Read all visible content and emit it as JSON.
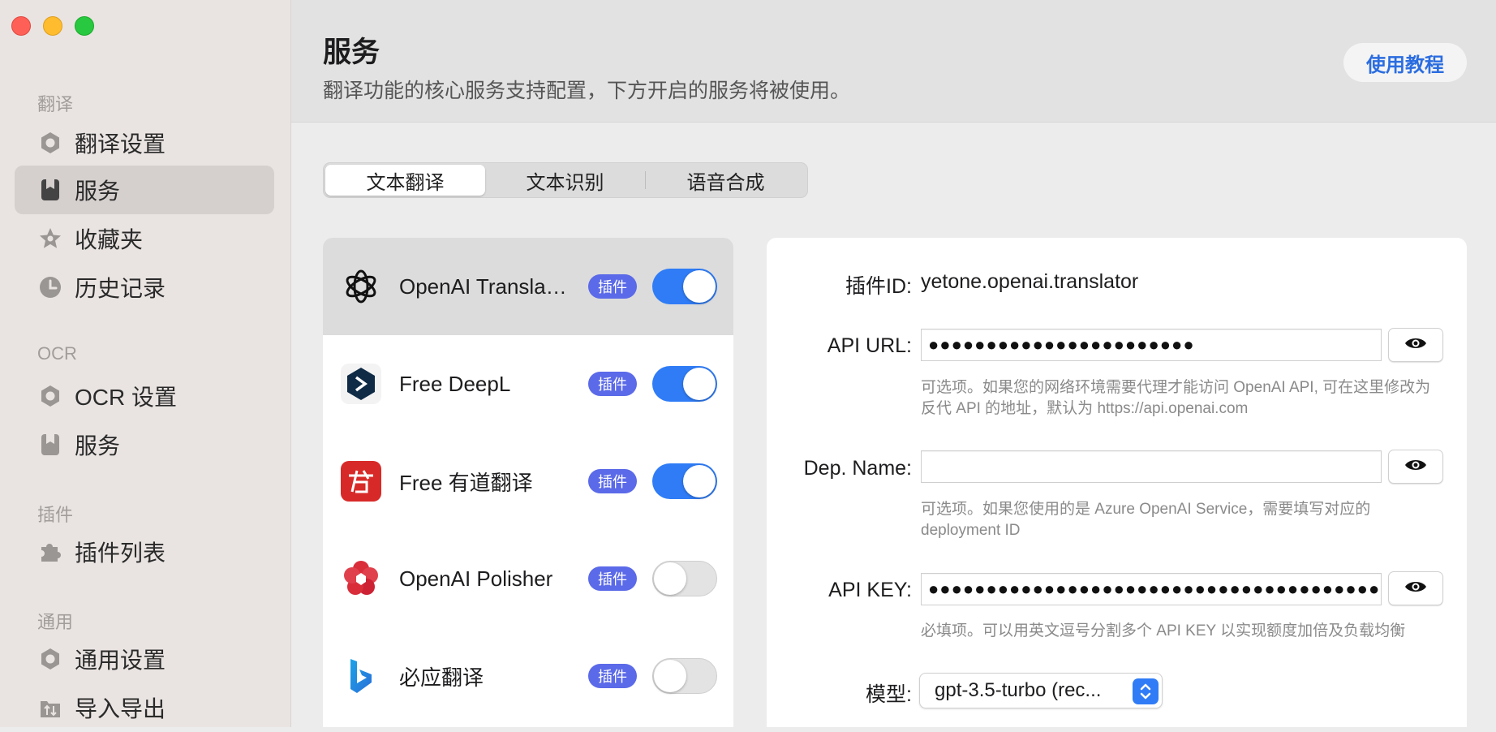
{
  "window": {
    "controls": [
      "close",
      "minimize",
      "zoom"
    ]
  },
  "sidebar": {
    "sections": [
      {
        "title": "翻译",
        "items": [
          {
            "label": "翻译设置",
            "icon": "gear-icon"
          },
          {
            "label": "服务",
            "icon": "bookmark-icon",
            "active": true
          },
          {
            "label": "收藏夹",
            "icon": "star-icon"
          },
          {
            "label": "历史记录",
            "icon": "clock-icon"
          }
        ]
      },
      {
        "title": "OCR",
        "items": [
          {
            "label": "OCR 设置",
            "icon": "gear-icon"
          },
          {
            "label": "服务",
            "icon": "bookmark-icon"
          }
        ]
      },
      {
        "title": "插件",
        "items": [
          {
            "label": "插件列表",
            "icon": "puzzle-icon"
          }
        ]
      },
      {
        "title": "通用",
        "items": [
          {
            "label": "通用设置",
            "icon": "gear-icon"
          },
          {
            "label": "导入导出",
            "icon": "import-export-icon"
          }
        ]
      }
    ]
  },
  "header": {
    "title": "服务",
    "subtitle": "翻译功能的核心服务支持配置，下方开启的服务将被使用。",
    "tutorial_label": "使用教程"
  },
  "tabs": [
    {
      "label": "文本翻译",
      "active": true
    },
    {
      "label": "文本识别"
    },
    {
      "label": "语音合成"
    }
  ],
  "services": [
    {
      "name": "OpenAI Translator",
      "badge": "插件",
      "enabled": true,
      "selected": true,
      "logo": "openai-logo"
    },
    {
      "name": "Free DeepL",
      "badge": "插件",
      "enabled": true,
      "logo": "deepl-logo"
    },
    {
      "name": "Free 有道翻译",
      "badge": "插件",
      "enabled": true,
      "logo": "youdao-logo"
    },
    {
      "name": "OpenAI Polisher",
      "badge": "插件",
      "enabled": false,
      "logo": "polisher-logo"
    },
    {
      "name": "必应翻译",
      "badge": "插件",
      "enabled": false,
      "logo": "bing-logo"
    }
  ],
  "config": {
    "plugin_id": {
      "label": "插件ID:",
      "value": "yetone.openai.translator"
    },
    "api_url": {
      "label": "API URL:",
      "value": "●●●●●●●●●●●●●●●●●●●●●●●",
      "help": "可选项。如果您的网络环境需要代理才能访问 OpenAI API, 可在这里修改为反代 API 的地址，默认为 https://api.openai.com"
    },
    "dep_name": {
      "label": "Dep. Name:",
      "value": "",
      "help": "可选项。如果您使用的是 Azure OpenAI Service，需要填写对应的 deployment ID"
    },
    "api_key": {
      "label": "API KEY:",
      "value": "●●●●●●●●●●●●●●●●●●●●●●●●●●●●●●●●●●●●●●●●●●●●●●●",
      "help": "必填项。可以用英文逗号分割多个 API KEY 以实现额度加倍及负载均衡"
    },
    "model": {
      "label": "模型:",
      "value": "gpt-3.5-turbo (rec..."
    }
  },
  "colors": {
    "accent": "#2f7cf6",
    "badge": "#5b6ae8",
    "tutorial_text": "#2b6de0"
  }
}
